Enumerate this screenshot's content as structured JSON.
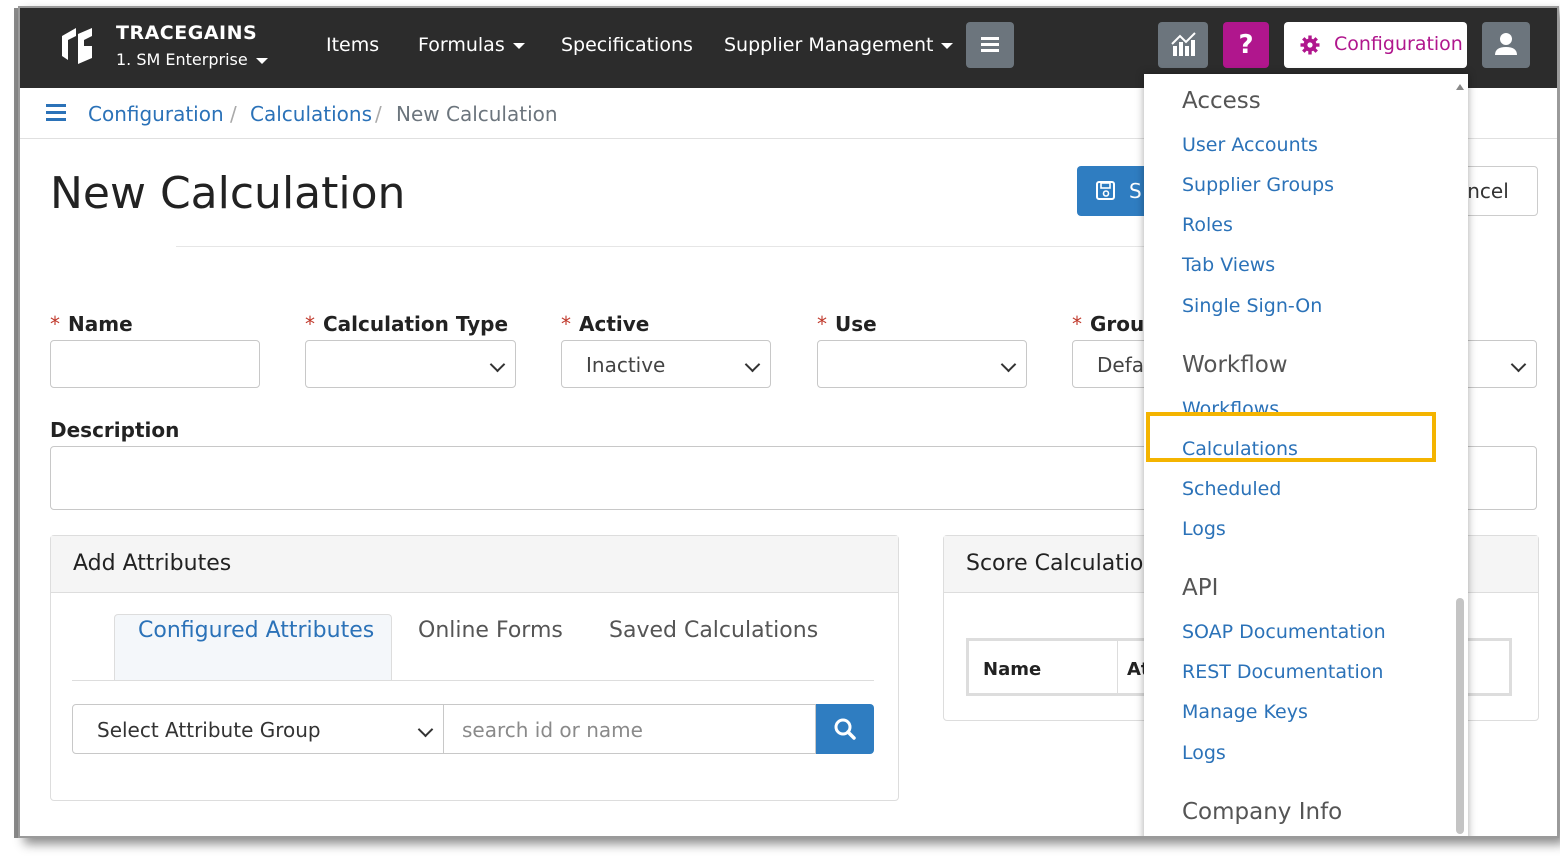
{
  "navbar": {
    "brand": "TRACEGAINS",
    "enterprise": "1. SM Enterprise",
    "links": {
      "items": "Items",
      "formulas": "Formulas",
      "specifications": "Specifications",
      "supplier_management": "Supplier Management"
    },
    "help_label": "?",
    "configuration_label": "Configuration",
    "accent_color": "#b0168d"
  },
  "breadcrumb": {
    "items": [
      "Configuration",
      "Calculations"
    ],
    "current": "New Calculation",
    "separator": "/"
  },
  "page": {
    "title": "New Calculation",
    "save_label": "S",
    "cancel_label": "ancel"
  },
  "form": {
    "name_label": "Name",
    "calc_type_label": "Calculation Type",
    "active_label": "Active",
    "active_value": "Inactive",
    "use_label": "Use",
    "group_label": "Group",
    "group_value": "Defau",
    "required_mark": "*",
    "description_label": "Description"
  },
  "attributes_panel": {
    "title": "Add Attributes",
    "tabs": [
      "Configured Attributes",
      "Online Forms",
      "Saved Calculations"
    ],
    "active_tab": "Configured Attributes",
    "group_select": "Select Attribute Group",
    "search_placeholder": "search id or name"
  },
  "score_panel": {
    "title": "Score Calculatio",
    "columns": [
      "Name",
      "At"
    ]
  },
  "config_menu": {
    "access_heading": "Access",
    "access_items": [
      "User Accounts",
      "Supplier Groups",
      "Roles",
      "Tab Views",
      "Single Sign-On"
    ],
    "workflow_heading": "Workflow",
    "workflow_items": [
      "Workflows",
      "Calculations",
      "Scheduled",
      "Logs"
    ],
    "api_heading": "API",
    "api_items": [
      "SOAP Documentation",
      "REST Documentation",
      "Manage Keys",
      "Logs"
    ],
    "company_heading": "Company Info",
    "highlighted_item": "Calculations",
    "highlight_color": "#f4b400"
  }
}
